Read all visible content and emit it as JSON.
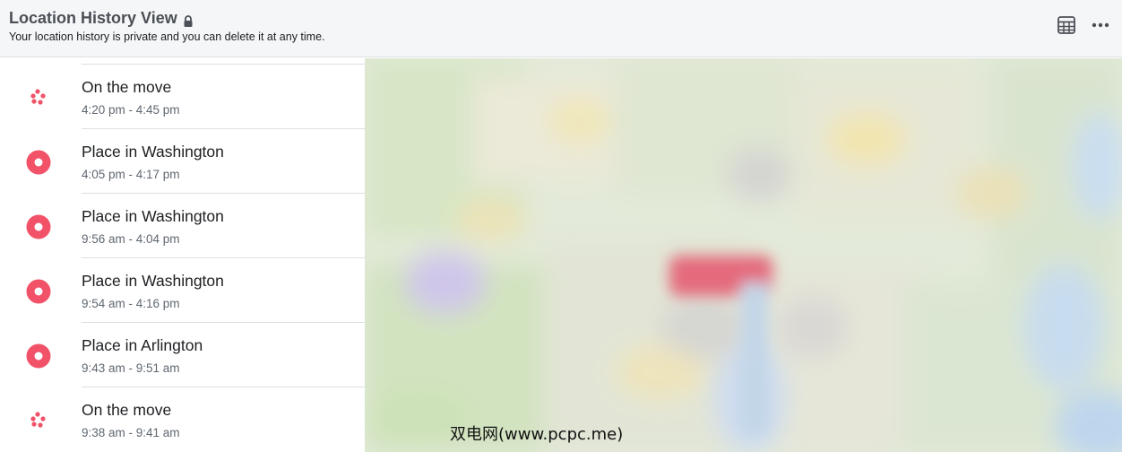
{
  "header": {
    "title": "Location History View",
    "subtitle": "Your location history is private and you can delete it at any time."
  },
  "colors": {
    "accent": "#f25268",
    "header_bg": "#f5f6f7",
    "divider": "#dddfe2"
  },
  "icons": {
    "title": "lock-icon",
    "actions": [
      "table-view-icon",
      "more-options-icon"
    ]
  },
  "items": [
    {
      "type": "move",
      "icon": "on-the-move-icon",
      "name": "On the move",
      "time": "4:20 pm - 4:45 pm"
    },
    {
      "type": "place",
      "icon": "place-marker-icon",
      "name": "Place in Washington",
      "time": "4:05 pm - 4:17 pm"
    },
    {
      "type": "place",
      "icon": "place-marker-icon",
      "name": "Place in Washington",
      "time": "9:56 am - 4:04 pm"
    },
    {
      "type": "place",
      "icon": "place-marker-icon",
      "name": "Place in Washington",
      "time": "9:54 am - 4:16 pm"
    },
    {
      "type": "place",
      "icon": "place-marker-icon",
      "name": "Place in Arlington",
      "time": "9:43 am - 9:51 am"
    },
    {
      "type": "move",
      "icon": "on-the-move-icon",
      "name": "On the move",
      "time": "9:38 am - 9:41 am"
    }
  ],
  "watermark": "双电网(www.pcpc.me)"
}
